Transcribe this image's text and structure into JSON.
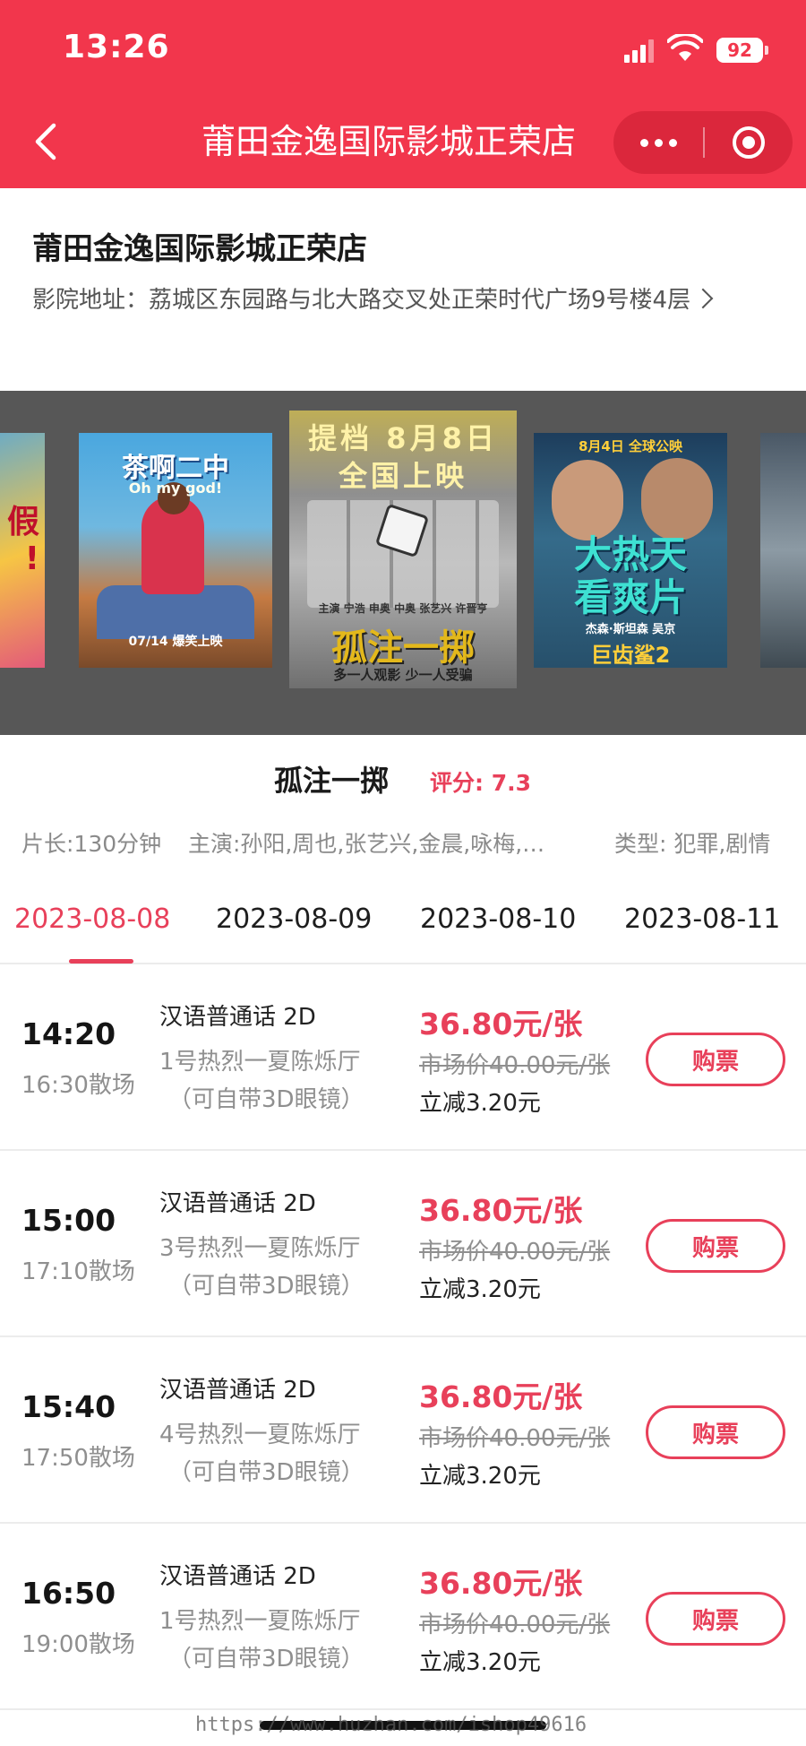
{
  "status_bar": {
    "time": "13:26",
    "battery": "92"
  },
  "nav": {
    "title": "莆田金逸国际影城正荣店"
  },
  "cinema": {
    "name": "莆田金逸国际影城正荣店",
    "address_label": "影院地址：",
    "address": "荔城区东园路与北大路交叉处正荣时代广场9号楼4层"
  },
  "posters": [
    {
      "title_lines": [
        "假",
        "!"
      ]
    },
    {
      "title": "茶啊二中",
      "subtitle": "Oh my god!",
      "date": "07/14 爆笑上映"
    },
    {
      "banner_1": "提档 8月8日",
      "banner_2": "全国上映",
      "cast": "主演 宁浩 申奥 中奥 张艺兴 许晋亨",
      "title": "孤注一掷",
      "slogan": "多一人观影 少一人受骗"
    },
    {
      "top_text": "8月4日 全球公映",
      "title_1": "大热天",
      "title_2": "看爽片",
      "cast": "杰森·斯坦森 吴京",
      "logo": "巨齿鲨2"
    },
    {}
  ],
  "movie": {
    "title": "孤注一掷",
    "rating": "评分: 7.3",
    "duration": "片长:130分钟",
    "cast": "主演:孙阳,周也,张艺兴,金晨,咏梅,…",
    "genre": "类型: 犯罪,剧情"
  },
  "date_tabs": [
    "2023-08-08",
    "2023-08-09",
    "2023-08-10",
    "2023-08-11"
  ],
  "showtimes": [
    {
      "start": "14:20",
      "end": "16:30散场",
      "lang": "汉语普通话 2D",
      "hall": "1号热烈一夏陈烁厅",
      "note": "（可自带3D眼镜）",
      "price": "36.80元/张",
      "market": "市场价40.00元/张",
      "discount": "立减3.20元",
      "buy": "购票"
    },
    {
      "start": "15:00",
      "end": "17:10散场",
      "lang": "汉语普通话 2D",
      "hall": "3号热烈一夏陈烁厅",
      "note": "（可自带3D眼镜）",
      "price": "36.80元/张",
      "market": "市场价40.00元/张",
      "discount": "立减3.20元",
      "buy": "购票"
    },
    {
      "start": "15:40",
      "end": "17:50散场",
      "lang": "汉语普通话 2D",
      "hall": "4号热烈一夏陈烁厅",
      "note": "（可自带3D眼镜）",
      "price": "36.80元/张",
      "market": "市场价40.00元/张",
      "discount": "立减3.20元",
      "buy": "购票"
    },
    {
      "start": "16:50",
      "end": "19:00散场",
      "lang": "汉语普通话 2D",
      "hall": "1号热烈一夏陈烁厅",
      "note": "（可自带3D眼镜）",
      "price": "36.80元/张",
      "market": "市场价40.00元/张",
      "discount": "立减3.20元",
      "buy": "购票"
    }
  ],
  "watermark": "https://www.huzhan.com/ishop49616",
  "colors": {
    "brand": "#f2364c",
    "accent": "#e8405a",
    "muted": "#8f8f8f"
  }
}
